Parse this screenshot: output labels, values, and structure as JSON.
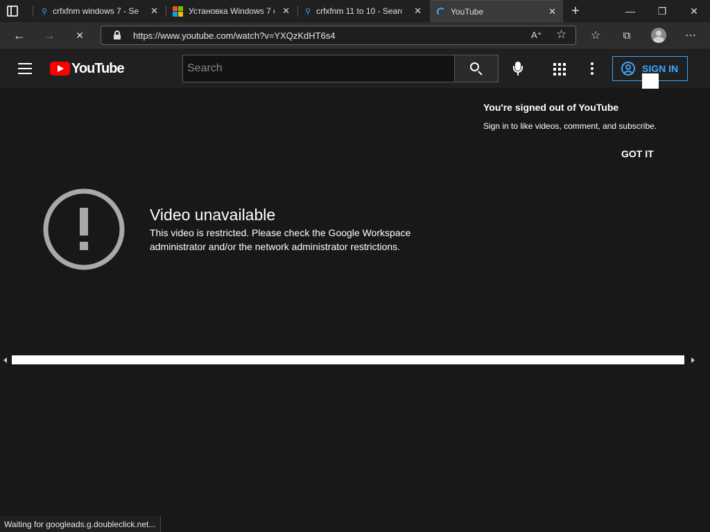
{
  "tabs": [
    {
      "title": "crfxfnm windows 7 - Se",
      "icon": "search-icon"
    },
    {
      "title": "Установка Windows 7 с",
      "icon": "windows-logo-icon"
    },
    {
      "title": "crfxfnm 11 to 10 - Searc",
      "icon": "search-icon"
    },
    {
      "title": "YouTube",
      "icon": "loading-spinner-icon"
    }
  ],
  "address": {
    "url": "https://www.youtube.com/watch?v=YXQzKdHT6s4"
  },
  "youtube": {
    "logo_text": "YouTube",
    "search_placeholder": "Search",
    "sign_in_label": "SIGN IN"
  },
  "popup": {
    "title": "You're signed out of YouTube",
    "body": "Sign in to like videos, comment, and subscribe.",
    "button": "GOT IT"
  },
  "error": {
    "title": "Video unavailable",
    "line1": "This video is restricted. Please check the Google Workspace",
    "line2": "administrator and/or the network administrator restrictions."
  },
  "status_text": "Waiting for googleads.g.doubleclick.net...",
  "colors": {
    "accent": "#3ea6ff",
    "youtube_red": "#ff0000",
    "active_tab": "#3a3a3a"
  }
}
